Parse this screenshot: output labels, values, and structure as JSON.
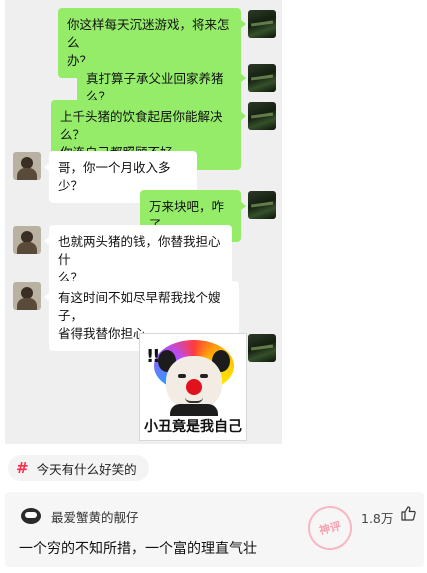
{
  "chat": {
    "messages": [
      {
        "side": "right",
        "lines": [
          "你这样每天沉迷游戏，将来怎么",
          "办？"
        ]
      },
      {
        "side": "right",
        "lines": [
          "真打算子承父业回家养猪么？"
        ]
      },
      {
        "side": "right",
        "lines": [
          "上千头猪的饮食起居你能解决么？",
          "你连自己都照顾不好"
        ]
      },
      {
        "side": "left",
        "lines": [
          "哥，你一个月收入多少？"
        ]
      },
      {
        "side": "right",
        "lines": [
          "万来块吧，咋了"
        ]
      },
      {
        "side": "left",
        "lines": [
          "也就两头猪的钱，你替我担心什",
          "么？"
        ]
      },
      {
        "side": "left",
        "lines": [
          "有这时间不如尽早帮我找个嫂子，",
          "省得我替你担心"
        ]
      }
    ],
    "sticker": {
      "marks": "!!",
      "caption": "小丑竟是我自己"
    }
  },
  "topic": {
    "label": "今天有什么好笑的"
  },
  "comment": {
    "username": "最爱蟹黄的靓仔",
    "likes": "1.8万",
    "text": "一个穷的不知所措，一个富的理直气壮",
    "stamp": "神评"
  },
  "colors": {
    "bubble_green": "#95ec69",
    "chat_bg": "#efefef",
    "topic_hash": "#ff2e4d"
  }
}
